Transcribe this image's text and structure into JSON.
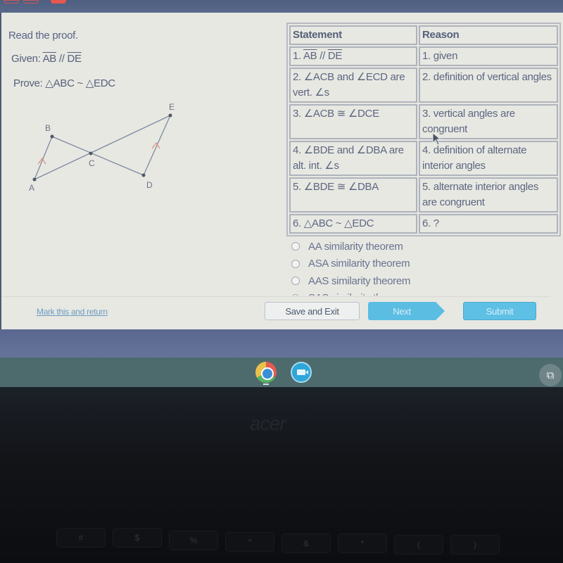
{
  "question": {
    "instruction": "Read the proof.",
    "given_prefix": "Given: ",
    "given_seg1": "AB",
    "given_parallel": " // ",
    "given_seg2": "DE",
    "prove": "Prove: △ABC ~ △EDC"
  },
  "figure": {
    "points": [
      {
        "label": "A"
      },
      {
        "label": "B"
      },
      {
        "label": "C"
      },
      {
        "label": "D"
      },
      {
        "label": "E"
      }
    ],
    "tick_color": "#e58a7a",
    "line_color": "#7d8aa0"
  },
  "proof": {
    "headers": {
      "statement": "Statement",
      "reason": "Reason"
    },
    "rows": [
      {
        "statement_prefix": "1. ",
        "seg1": "AB",
        "parallel": " // ",
        "seg2": "DE",
        "reason": "1. given"
      },
      {
        "statement": "2. ∠ACB and ∠ECD are vert. ∠s",
        "reason": "2. definition of vertical angles"
      },
      {
        "statement": "3. ∠ACB ≅ ∠DCE",
        "reason": "3. vertical angles are congruent"
      },
      {
        "statement": "4. ∠BDE and ∠DBA are alt. int. ∠s",
        "reason": "4. definition of alternate interior angles"
      },
      {
        "statement": "5. ∠BDE ≅ ∠DBA",
        "reason": "5. alternate interior angles are congruent"
      },
      {
        "statement": "6. △ABC ~ △EDC",
        "reason": "6. ?"
      }
    ]
  },
  "choices": [
    {
      "label": "AA similarity theorem",
      "selected": false
    },
    {
      "label": "ASA similarity theorem",
      "selected": false
    },
    {
      "label": "AAS similarity theorem",
      "selected": false
    },
    {
      "label": "SAS similarity theorem",
      "selected": false
    }
  ],
  "footer": {
    "mark_link": "Mark this and return",
    "save_exit": "Save and Exit",
    "next": "Next",
    "submit": "Submit"
  },
  "shelf": {
    "apps": [
      {
        "icon": "chrome-icon",
        "active": true
      },
      {
        "icon": "video-meet-icon",
        "active": false
      }
    ],
    "overview_icon": "⧉"
  },
  "bezel": {
    "brand": "acer",
    "keys": [
      "#",
      "$",
      "%",
      "^",
      "&",
      "*",
      "(",
      ")"
    ]
  },
  "colors": {
    "accent_button": "#5bbde2",
    "text": "#5d6680",
    "link": "#6a9bc2",
    "page_bg": "#e7e8e2"
  }
}
